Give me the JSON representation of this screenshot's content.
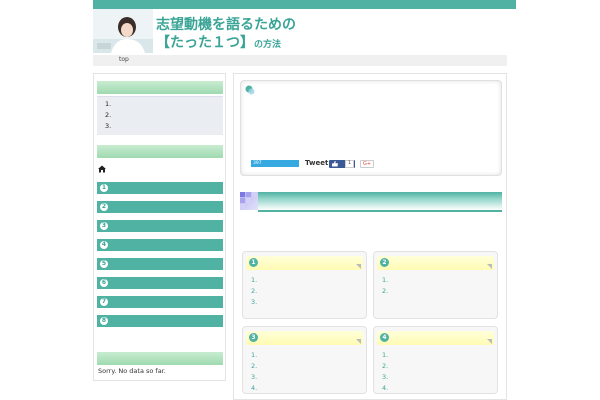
{
  "header": {
    "title_line1": "志望動機を語るための",
    "title_line2_main": "【たった１つ】",
    "title_line2_suffix": "の方法"
  },
  "nav": {
    "top_label": "top"
  },
  "sidebar": {
    "toc_items": [
      "1.",
      "2.",
      "3."
    ],
    "ranking_numbers": [
      "1",
      "2",
      "3",
      "4",
      "5",
      "6",
      "7",
      "8"
    ],
    "no_data_text": "Sorry. No data so far."
  },
  "share": {
    "count": "397",
    "tweet_label": "Tweet",
    "fb_count": "1",
    "gplus_label": "G+"
  },
  "cards": [
    {
      "number": "1",
      "items": [
        "1.",
        "2.",
        "3."
      ]
    },
    {
      "number": "2",
      "items": [
        "1.",
        "2."
      ]
    },
    {
      "number": "3",
      "items": [
        "1.",
        "2.",
        "3.",
        "4."
      ]
    },
    {
      "number": "4",
      "items": [
        "1.",
        "2.",
        "3.",
        "4."
      ]
    }
  ],
  "colors": {
    "accent": "#4fb2a3",
    "title": "#3aa596",
    "sidebar_head": "#9edab0",
    "card_head": "#fffbb3"
  }
}
